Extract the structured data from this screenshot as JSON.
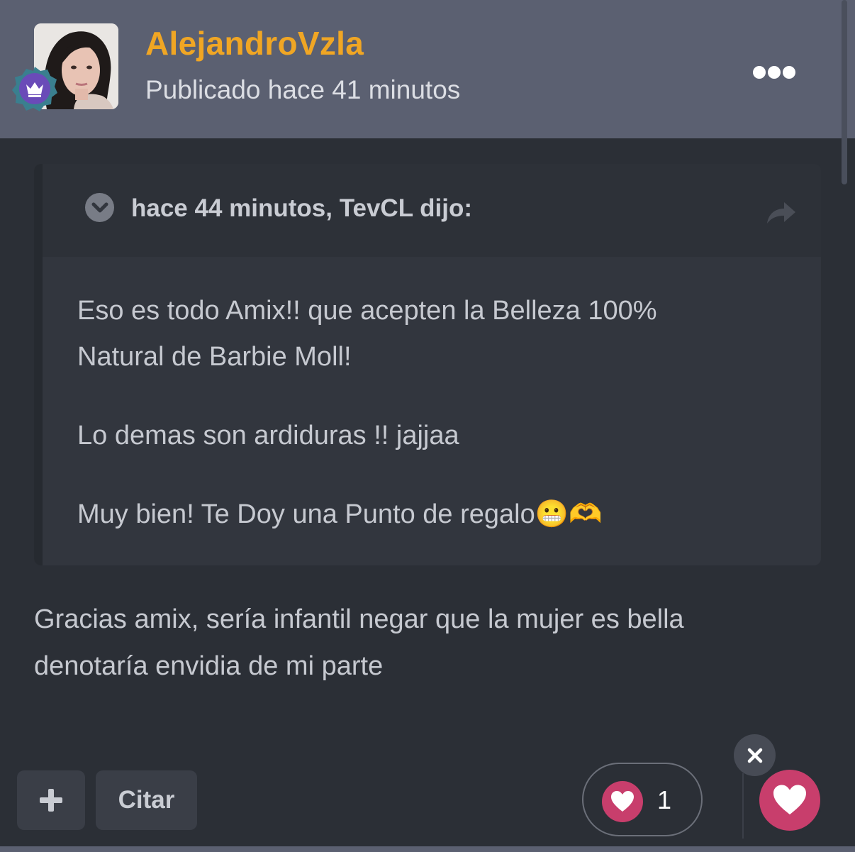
{
  "post": {
    "author": "AlejandroVzla",
    "posted": "Publicado hace 41 minutos"
  },
  "quote": {
    "title": "hace 44 minutos, TevCL dijo:",
    "line1": "Eso es todo Amix!! que acepten la Belleza 100%",
    "line2": "Natural de Barbie Moll!",
    "line3": "Lo demas son ardiduras !!  jajjaa",
    "line4": "Muy bien! Te Doy una Punto de regalo😬🫶"
  },
  "reply": {
    "line1": "Gracias amix, sería infantil negar que la mujer es bella",
    "line2": "denotaría envidia de mi parte"
  },
  "actions": {
    "plus_label": "+",
    "cite_label": "Citar",
    "reaction_count": "1"
  },
  "colors": {
    "accent_author": "#f0a624",
    "like": "#c83e6c",
    "header_bg": "#5b6071",
    "page_bg": "#2b2f36"
  }
}
